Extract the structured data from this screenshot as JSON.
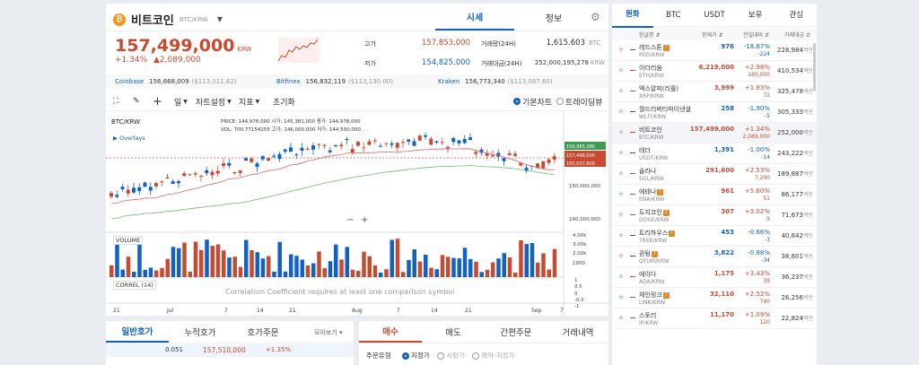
{
  "coin": {
    "name": "비트코인",
    "pair": "BTC/KRW",
    "price": "157,499,000",
    "currency": "KRW",
    "change_pct": "+1.34%",
    "change_amt": "▲2,089,000"
  },
  "tabs": [
    "시세",
    "정보"
  ],
  "stats": {
    "high_label": "고가",
    "high": "157,853,000",
    "low_label": "저가",
    "low": "154,825,000",
    "vol_label": "거래량(24H)",
    "vol": "1,615.603",
    "vol_unit": "BTC",
    "amt_label": "거래대금(24H)",
    "amt": "252,000,195,278",
    "amt_unit": "KRW"
  },
  "exchanges": [
    {
      "name": "Coinbase",
      "price": "156,668,009",
      "usd": "($113,011.62)"
    },
    {
      "name": "Bitfinex",
      "price": "156,832,119",
      "usd": "($113,130.00)"
    },
    {
      "name": "Kraken",
      "price": "156,773,340",
      "usd": "($113,087.60)"
    }
  ],
  "toolbar": {
    "interval": "일",
    "chart_settings": "차트설정",
    "indicators": "지표",
    "reset": "초기화",
    "basic_chart": "기본차트",
    "tradingview": "트레이딩뷰"
  },
  "chart": {
    "symbol": "BTC/KRW",
    "overlays": "Overlays",
    "info_row1": "PRICE: 144,978,000   시가: 145,381,000   종가: 144,978,000",
    "info_row2": "VOL: 700.77154255   고가: 146,000,000   저가: 144,500,000",
    "volume_label": "VOLUME",
    "correl_label": "CORREL (14)",
    "correl_msg": "Correlation Coefficient requires at least one comparison symbol",
    "zoom_minus": "−",
    "zoom_plus": "+",
    "price_ticks": [
      "150,000,000",
      "140,000,000"
    ],
    "vol_ticks": [
      "4.00k",
      "3.00k",
      "2.00k",
      "1000"
    ],
    "correl_ticks": [
      "1",
      "0.5",
      "0",
      "-0.5",
      "-1"
    ],
    "x_ticks": [
      "21",
      "Jul",
      "7",
      "14",
      "21",
      "Aug",
      "7",
      "14",
      "21",
      "Sep",
      "7"
    ],
    "price_tags": [
      "159,983,280",
      "157,499,000",
      "155,557,800"
    ]
  },
  "orderbook_tabs": [
    "일반호가",
    "누적호가",
    "호가주문"
  ],
  "orderbook": {
    "view": "모아보기 ▾",
    "row_qty": "0.051",
    "row_price": "157,510,000",
    "row_pct": "+1.35%"
  },
  "order_tabs": [
    "매수",
    "매도",
    "간편주문",
    "거래내역"
  ],
  "order": {
    "type_label": "주문유형",
    "opt1": "지정가",
    "opt2": "시장가",
    "opt3": "예약-지정가"
  },
  "market_tabs": [
    "원화",
    "BTC",
    "USDT",
    "보유",
    "관심"
  ],
  "market_cols": [
    "한글명 ⇵",
    "현재가 ⇵",
    "전일대비 ⇵",
    "거래대금 ⇵"
  ],
  "markets": [
    {
      "name": "레드스톤",
      "sym": "RED/KRW",
      "price": "976",
      "ch": "-18.67%",
      "chd": "-224",
      "vol": "228,984",
      "unit": "백만",
      "dir": "down",
      "badge": "W"
    },
    {
      "name": "이더리움",
      "sym": "ETH/KRW",
      "price": "6,219,000",
      "ch": "+2.98%",
      "chd": "180,000",
      "vol": "410,534",
      "unit": "백만",
      "dir": "up",
      "badge": ""
    },
    {
      "name": "엑스알피(리플)",
      "sym": "XRP/KRW",
      "price": "3,999",
      "ch": "+1.83%",
      "chd": "72",
      "vol": "325,478",
      "unit": "백만",
      "dir": "up",
      "badge": ""
    },
    {
      "name": "월드리버티파이낸셜",
      "sym": "WLFI/KRW",
      "price": "258",
      "ch": "-1.90%",
      "chd": "-5",
      "vol": "305,333",
      "unit": "백만",
      "dir": "down",
      "badge": ""
    },
    {
      "name": "비트코인",
      "sym": "BTC/KRW",
      "price": "157,499,000",
      "ch": "+1.34%",
      "chd": "2,089,000",
      "vol": "252,000",
      "unit": "백만",
      "dir": "up",
      "badge": ""
    },
    {
      "name": "테더",
      "sym": "USDT/KRW",
      "price": "1,391",
      "ch": "-1.00%",
      "chd": "-14",
      "vol": "243,222",
      "unit": "백만",
      "dir": "down",
      "badge": ""
    },
    {
      "name": "솔라나",
      "sym": "SOL/KRW",
      "price": "291,600",
      "ch": "+2.53%",
      "chd": "7,200",
      "vol": "189,887",
      "unit": "백만",
      "dir": "up",
      "badge": ""
    },
    {
      "name": "에테나",
      "sym": "ENA/KRW",
      "price": "961",
      "ch": "+5.60%",
      "chd": "51",
      "vol": "86,177",
      "unit": "백만",
      "dir": "up",
      "badge": "W"
    },
    {
      "name": "도지코인",
      "sym": "DOGE/KRW",
      "price": "307",
      "ch": "+3.02%",
      "chd": "9",
      "vol": "71,673",
      "unit": "백만",
      "dir": "up",
      "badge": "W"
    },
    {
      "name": "트리하우스",
      "sym": "TREE/KRW",
      "price": "453",
      "ch": "-0.66%",
      "chd": "-3",
      "vol": "40,642",
      "unit": "백만",
      "dir": "down",
      "badge": "W"
    },
    {
      "name": "퀀텀",
      "sym": "QTUM/KRW",
      "price": "3,822",
      "ch": "-0.88%",
      "chd": "-34",
      "vol": "38,601",
      "unit": "백만",
      "dir": "down",
      "badge": "W"
    },
    {
      "name": "에이다",
      "sym": "ADA/KRW",
      "price": "1,175",
      "ch": "+3.43%",
      "chd": "39",
      "vol": "36,237",
      "unit": "백만",
      "dir": "up",
      "badge": ""
    },
    {
      "name": "체인링크",
      "sym": "LINK/KRW",
      "price": "32,110",
      "ch": "+2.52%",
      "chd": "790",
      "vol": "26,256",
      "unit": "백만",
      "dir": "up",
      "badge": "W"
    },
    {
      "name": "스토리",
      "sym": "IP/KRW",
      "price": "11,170",
      "ch": "+1.09%",
      "chd": "120",
      "vol": "22,824",
      "unit": "백만",
      "dir": "up",
      "badge": ""
    }
  ],
  "colors": {
    "up": "#c84a31",
    "down": "#1261c4",
    "accent": "#1261c4"
  }
}
